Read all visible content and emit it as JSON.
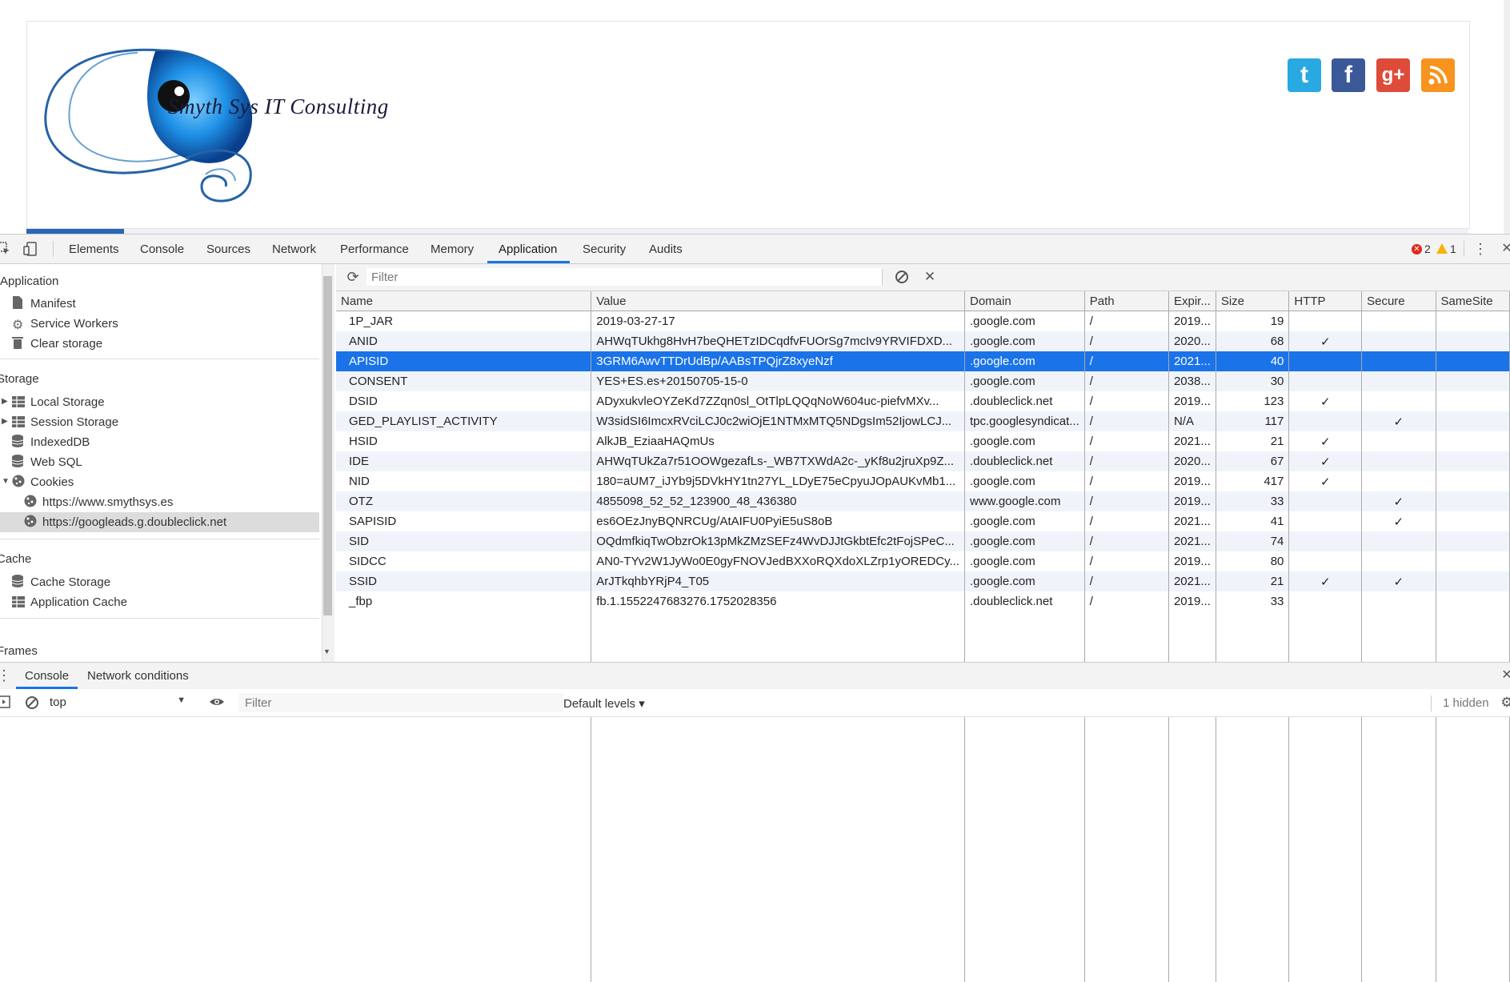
{
  "site": {
    "logo_text": "Smyth Sys IT Consulting",
    "social": [
      {
        "name": "twitter",
        "glyph": "t",
        "color": "#29a9e1"
      },
      {
        "name": "facebook",
        "glyph": "f",
        "color": "#3b5998"
      },
      {
        "name": "google-plus",
        "glyph": "g+",
        "color": "#dd4b39"
      },
      {
        "name": "rss",
        "glyph": "",
        "color": "#f7931e"
      }
    ]
  },
  "devtools": {
    "tabs": [
      "Elements",
      "Console",
      "Sources",
      "Network",
      "Performance",
      "Memory",
      "Application",
      "Security",
      "Audits"
    ],
    "active_tab": "Application",
    "errors": "2",
    "warnings": "1"
  },
  "sidebar": {
    "application_header": "Application",
    "application_items": [
      "Manifest",
      "Service Workers",
      "Clear storage"
    ],
    "storage_header": "Storage",
    "storage_items": [
      "Local Storage",
      "Session Storage",
      "IndexedDB",
      "Web SQL",
      "Cookies"
    ],
    "cookie_sites": [
      "https://www.smythsys.es",
      "https://googleads.g.doubleclick.net"
    ],
    "cache_header": "Cache",
    "cache_items": [
      "Cache Storage",
      "Application Cache"
    ],
    "frames_header": "Frames"
  },
  "cookies": {
    "filter_placeholder": "Filter",
    "columns": [
      "Name",
      "Value",
      "Domain",
      "Path",
      "Expir...",
      "Size",
      "HTTP",
      "Secure",
      "SameSite"
    ],
    "selected_row": 2,
    "rows": [
      {
        "name": "1P_JAR",
        "value": "2019-03-27-17",
        "domain": ".google.com",
        "path": "/",
        "expires": "2019...",
        "size": "19",
        "http": "",
        "secure": "",
        "samesite": ""
      },
      {
        "name": "ANID",
        "value": "AHWqTUkhg8HvH7beQHETzIDCqdfvFUOrSg7mcIv9YRVIFDXD...",
        "domain": ".google.com",
        "path": "/",
        "expires": "2020...",
        "size": "68",
        "http": "✓",
        "secure": "",
        "samesite": ""
      },
      {
        "name": "APISID",
        "value": "3GRM6AwvTTDrUdBp/AABsTPQjrZ8xyeNzf",
        "domain": ".google.com",
        "path": "/",
        "expires": "2021...",
        "size": "40",
        "http": "",
        "secure": "",
        "samesite": ""
      },
      {
        "name": "CONSENT",
        "value": "YES+ES.es+20150705-15-0",
        "domain": ".google.com",
        "path": "/",
        "expires": "2038...",
        "size": "30",
        "http": "",
        "secure": "",
        "samesite": ""
      },
      {
        "name": "DSID",
        "value": "ADyxukvleOYZeKd7ZZqn0sl_OtTlpLQQqNoW604uc-piefvMXv...",
        "domain": ".doubleclick.net",
        "path": "/",
        "expires": "2019...",
        "size": "123",
        "http": "✓",
        "secure": "",
        "samesite": ""
      },
      {
        "name": "GED_PLAYLIST_ACTIVITY",
        "value": "W3sidSI6ImcxRVciLCJ0c2wiOjE1NTMxMTQ5NDgsIm52IjowLCJ...",
        "domain": "tpc.googlesyndicat...",
        "path": "/",
        "expires": "N/A",
        "size": "117",
        "http": "",
        "secure": "✓",
        "samesite": ""
      },
      {
        "name": "HSID",
        "value": "AlkJB_EziaaHAQmUs",
        "domain": ".google.com",
        "path": "/",
        "expires": "2021...",
        "size": "21",
        "http": "✓",
        "secure": "",
        "samesite": ""
      },
      {
        "name": "IDE",
        "value": "AHWqTUkZa7r51OOWgezafLs-_WB7TXWdA2c-_yKf8u2jruXp9Z...",
        "domain": ".doubleclick.net",
        "path": "/",
        "expires": "2020...",
        "size": "67",
        "http": "✓",
        "secure": "",
        "samesite": ""
      },
      {
        "name": "NID",
        "value": "180=aUM7_iJYb9j5DVkHY1tn27YL_LDyE75eCpyuJOpAUKvMb1...",
        "domain": ".google.com",
        "path": "/",
        "expires": "2019...",
        "size": "417",
        "http": "✓",
        "secure": "",
        "samesite": ""
      },
      {
        "name": "OTZ",
        "value": "4855098_52_52_123900_48_436380",
        "domain": "www.google.com",
        "path": "/",
        "expires": "2019...",
        "size": "33",
        "http": "",
        "secure": "✓",
        "samesite": ""
      },
      {
        "name": "SAPISID",
        "value": "es6OEzJnyBQNRCUg/AtAIFU0PyiE5uS8oB",
        "domain": ".google.com",
        "path": "/",
        "expires": "2021...",
        "size": "41",
        "http": "",
        "secure": "✓",
        "samesite": ""
      },
      {
        "name": "SID",
        "value": "OQdmfkiqTwObzrOk13pMkZMzSEFz4WvDJJtGkbtEfc2tFojSPeC...",
        "domain": ".google.com",
        "path": "/",
        "expires": "2021...",
        "size": "74",
        "http": "",
        "secure": "",
        "samesite": ""
      },
      {
        "name": "SIDCC",
        "value": "AN0-TYv2W1JyWo0E0gyFNOVJedBXXoRQXdoXLZrp1yOREDCy...",
        "domain": ".google.com",
        "path": "/",
        "expires": "2019...",
        "size": "80",
        "http": "",
        "secure": "",
        "samesite": ""
      },
      {
        "name": "SSID",
        "value": "ArJTkqhbYRjP4_T05",
        "domain": ".google.com",
        "path": "/",
        "expires": "2021...",
        "size": "21",
        "http": "✓",
        "secure": "✓",
        "samesite": ""
      },
      {
        "name": "_fbp",
        "value": "fb.1.1552247683276.1752028356",
        "domain": ".doubleclick.net",
        "path": "/",
        "expires": "2019...",
        "size": "33",
        "http": "",
        "secure": "",
        "samesite": ""
      }
    ]
  },
  "drawer": {
    "tabs": [
      "Console",
      "Network conditions"
    ],
    "context": "top",
    "filter_placeholder": "Filter",
    "levels": "Default levels ▾",
    "hidden": "1 hidden"
  }
}
